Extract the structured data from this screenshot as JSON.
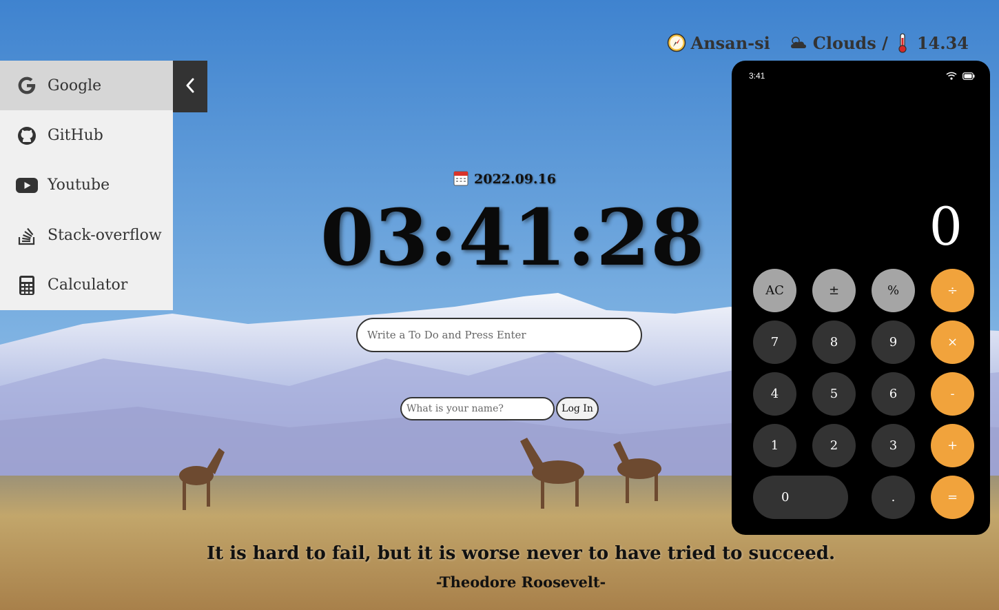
{
  "sidebar": {
    "items": [
      {
        "label": "Google",
        "icon": "google-icon"
      },
      {
        "label": "GitHub",
        "icon": "github-icon"
      },
      {
        "label": "Youtube",
        "icon": "youtube-icon"
      },
      {
        "label": "Stack-overflow",
        "icon": "stack-overflow-icon"
      },
      {
        "label": "Calculator",
        "icon": "calculator-icon"
      }
    ],
    "collapse_icon": "chevron-left-icon"
  },
  "weather": {
    "city": "Ansan-si",
    "condition": "Clouds /",
    "temperature": "14.34",
    "icons": [
      "compass-icon",
      "cloud-icon",
      "thermometer-icon"
    ]
  },
  "clock": {
    "date": "2022.09.16",
    "time": "03:41:28",
    "date_icon": "calendar-icon"
  },
  "todo": {
    "placeholder": "Write a To Do and Press Enter"
  },
  "login": {
    "placeholder": "What is your name?",
    "button": "Log In"
  },
  "quote": {
    "text": "It is hard to fail, but it is worse never to have tried to succeed.",
    "author": "-Theodore Roosevelt-"
  },
  "calculator": {
    "status_time": "3:41",
    "display": "0",
    "buttons": {
      "ac": "AC",
      "sign": "±",
      "percent": "%",
      "divide": "÷",
      "seven": "7",
      "eight": "8",
      "nine": "9",
      "multiply": "×",
      "four": "4",
      "five": "5",
      "six": "6",
      "minus": "-",
      "one": "1",
      "two": "2",
      "three": "3",
      "plus": "+",
      "zero": "0",
      "dot": ".",
      "equals": "="
    },
    "colors": {
      "function": "#a5a5a5",
      "number": "#333333",
      "operator": "#f1a33c"
    }
  }
}
